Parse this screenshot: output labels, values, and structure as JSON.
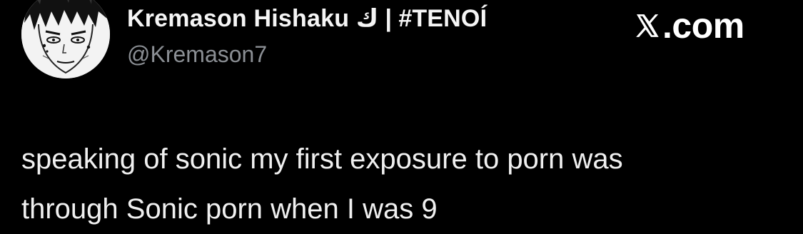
{
  "author": {
    "name": "Kremason Hishaku ك | #TENOÍ",
    "handle": "@Kremason7"
  },
  "brand": {
    "text": ".com",
    "logo_icon": "x-logo-icon"
  },
  "tweet": {
    "lines": [
      "speaking of sonic my first exposure to porn was",
      "through Sonic porn when I was 9"
    ]
  },
  "colors": {
    "background": "#000000",
    "name_text": "#f5f5f5",
    "handle_text": "#8b8f94",
    "body_text": "#f0f0f0"
  }
}
